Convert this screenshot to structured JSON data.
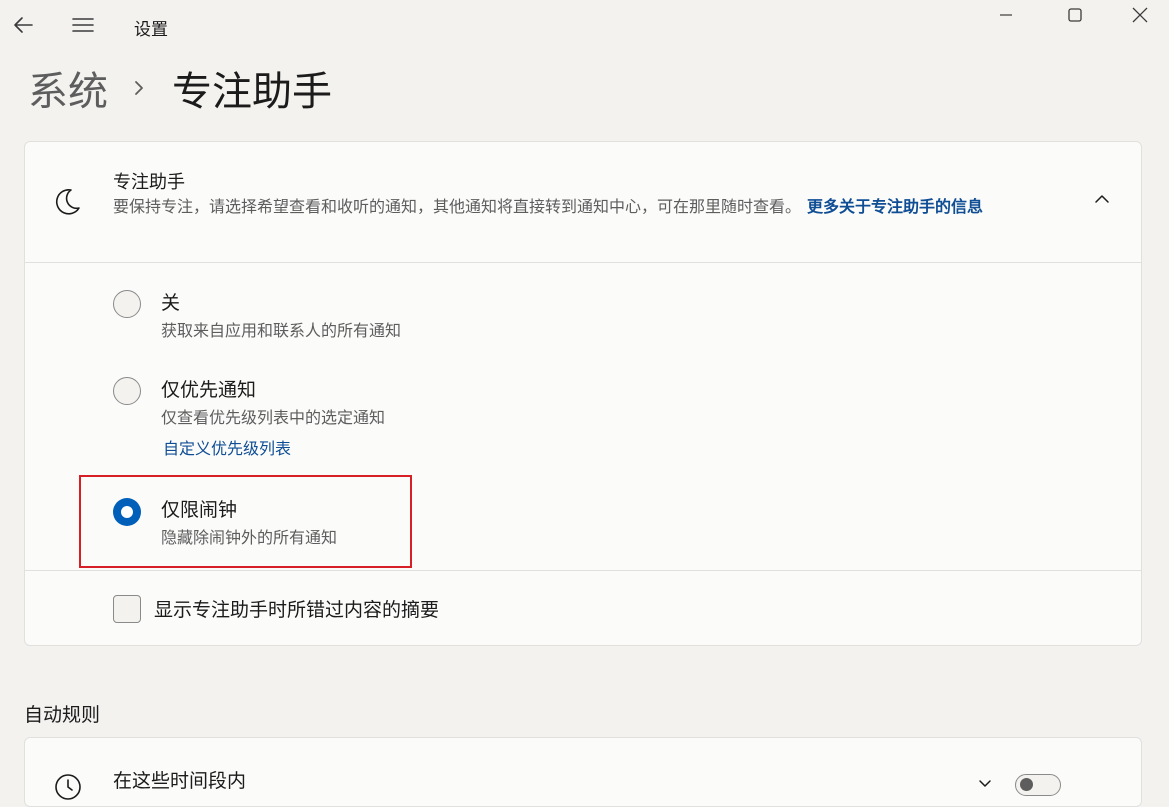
{
  "app": {
    "title": "设置"
  },
  "breadcrumb": {
    "parent": "系统",
    "current": "专注助手"
  },
  "focus_card": {
    "title": "专注助手",
    "description": "要保持专注，请选择希望查看和收听的通知，其他通知将直接转到通知中心，可在那里随时查看。",
    "link": "更多关于专注助手的信息",
    "options": [
      {
        "title": "关",
        "subtitle": "获取来自应用和联系人的所有通知",
        "checked": false
      },
      {
        "title": "仅优先通知",
        "subtitle": "仅查看优先级列表中的选定通知",
        "link": "自定义优先级列表",
        "checked": false
      },
      {
        "title": "仅限闹钟",
        "subtitle": "隐藏除闹钟外的所有通知",
        "checked": true
      }
    ],
    "summary_checkbox": {
      "label": "显示专注助手时所错过内容的摘要",
      "checked": false
    }
  },
  "auto_rules": {
    "section_title": "自动规则",
    "first_rule": {
      "title": "在这些时间段内"
    }
  },
  "icons": {
    "back": "back-arrow-icon",
    "menu": "hamburger-icon",
    "moon": "moon-icon",
    "clock": "clock-icon",
    "chevron_up": "chevron-up-icon",
    "chevron_down": "chevron-down-icon"
  },
  "colors": {
    "accent": "#005fb8",
    "link": "#0f4d94",
    "highlight_box": "#d61f26"
  }
}
